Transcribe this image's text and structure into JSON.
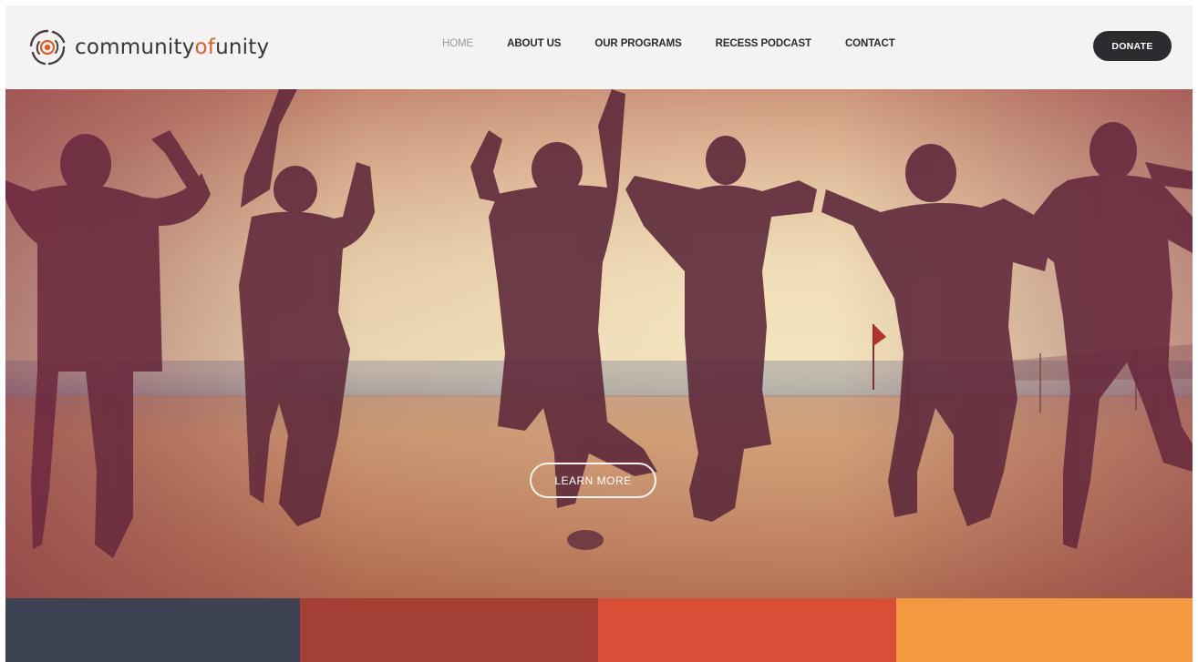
{
  "header": {
    "logo": {
      "text_main": "community",
      "text_of": "of",
      "text_end": "unity"
    },
    "nav": [
      {
        "label": "HOME",
        "active": true
      },
      {
        "label": "ABOUT US",
        "active": false
      },
      {
        "label": "OUR PROGRAMS",
        "active": false
      },
      {
        "label": "RECESS PODCAST",
        "active": false
      },
      {
        "label": "CONTACT",
        "active": false
      }
    ],
    "donate_label": "DONATE"
  },
  "hero": {
    "cta_label": "LEARN MORE",
    "image_description_icon": "hero-photo"
  },
  "color_blocks": [
    "#3c4252",
    "#a43f33",
    "#d94e36",
    "#f39a41"
  ],
  "colors": {
    "accent": "#d9612f",
    "dark": "#2c2b30"
  }
}
